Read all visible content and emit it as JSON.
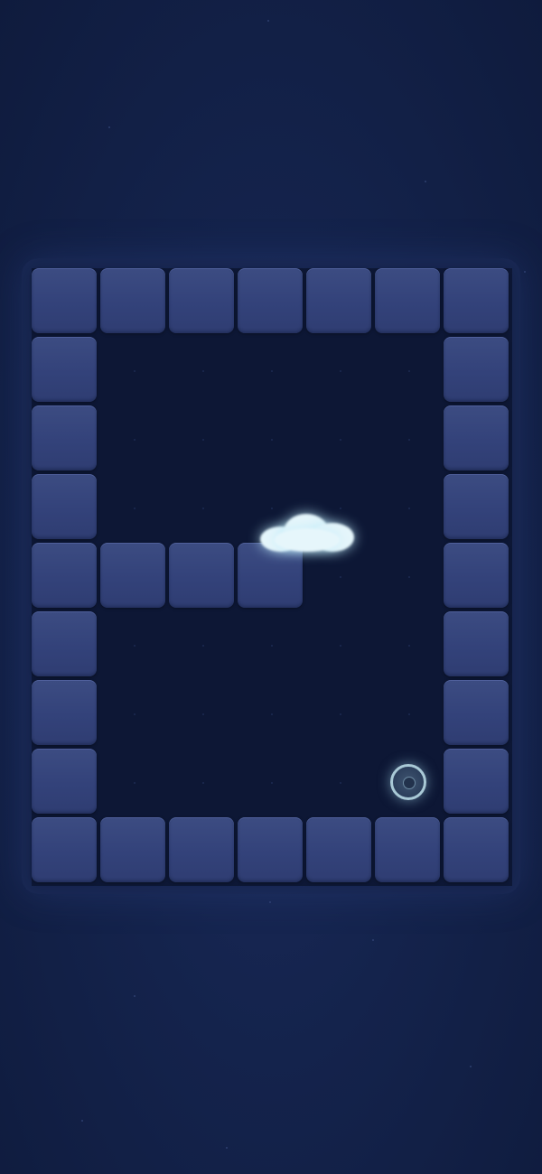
{
  "game": {
    "palette": {
      "background": "#14234c",
      "board_floor": "#0d1735",
      "wall_tile": "#36457c",
      "cloud": "#e6f6fb",
      "target_ring": "#a9c9d6"
    },
    "grid": {
      "columns": 7,
      "rows": 9
    },
    "wall_cells": [
      [
        0,
        0
      ],
      [
        1,
        0
      ],
      [
        2,
        0
      ],
      [
        3,
        0
      ],
      [
        4,
        0
      ],
      [
        5,
        0
      ],
      [
        6,
        0
      ],
      [
        0,
        1
      ],
      [
        6,
        1
      ],
      [
        0,
        2
      ],
      [
        6,
        2
      ],
      [
        0,
        3
      ],
      [
        6,
        3
      ],
      [
        0,
        4
      ],
      [
        1,
        4
      ],
      [
        2,
        4
      ],
      [
        3,
        4
      ],
      [
        6,
        4
      ],
      [
        0,
        5
      ],
      [
        6,
        5
      ],
      [
        0,
        6
      ],
      [
        6,
        6
      ],
      [
        0,
        7
      ],
      [
        6,
        7
      ],
      [
        0,
        8
      ],
      [
        1,
        8
      ],
      [
        2,
        8
      ],
      [
        3,
        8
      ],
      [
        4,
        8
      ],
      [
        5,
        8
      ],
      [
        6,
        8
      ]
    ],
    "player": {
      "icon": "cloud-icon"
    },
    "goal": {
      "icon": "target-ring-icon"
    }
  }
}
